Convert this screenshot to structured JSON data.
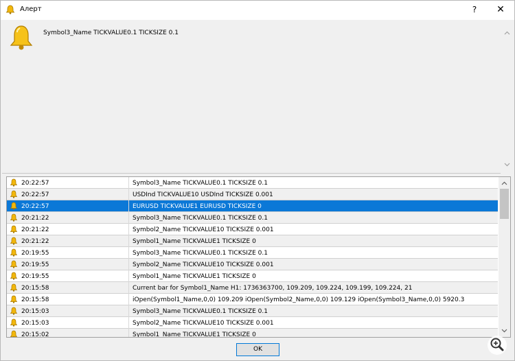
{
  "window": {
    "title": "Алерт",
    "help_label": "?",
    "close_label": "✕"
  },
  "message": {
    "text": "Symbol3_Name TICKVALUE0.1 TICKSIZE 0.1"
  },
  "alerts": [
    {
      "time": "20:22:57",
      "message": "Symbol3_Name TICKVALUE0.1 TICKSIZE 0.1",
      "selected": false
    },
    {
      "time": "20:22:57",
      "message": "USDInd TICKVALUE10 USDInd TICKSIZE 0.001",
      "selected": false
    },
    {
      "time": "20:22:57",
      "message": "EURUSD TICKVALUE1 EURUSD TICKSIZE 0",
      "selected": true
    },
    {
      "time": "20:21:22",
      "message": "Symbol3_Name TICKVALUE0.1 TICKSIZE 0.1",
      "selected": false
    },
    {
      "time": "20:21:22",
      "message": "Symbol2_Name TICKVALUE10 TICKSIZE 0.001",
      "selected": false
    },
    {
      "time": "20:21:22",
      "message": "Symbol1_Name TICKVALUE1 TICKSIZE 0",
      "selected": false
    },
    {
      "time": "20:19:55",
      "message": "Symbol3_Name TICKVALUE0.1 TICKSIZE 0.1",
      "selected": false
    },
    {
      "time": "20:19:55",
      "message": "Symbol2_Name TICKVALUE10 TICKSIZE 0.001",
      "selected": false
    },
    {
      "time": "20:19:55",
      "message": "Symbol1_Name TICKVALUE1 TICKSIZE 0",
      "selected": false
    },
    {
      "time": "20:15:58",
      "message": "Current bar for Symbol1_Name H1: 1736363700, 109.209, 109.224, 109.199, 109.224, 21",
      "selected": false
    },
    {
      "time": "20:15:58",
      "message": " iOpen(Symbol1_Name,0,0) 109.209 iOpen(Symbol2_Name,0,0) 109.129 iOpen(Symbol3_Name,0,0) 5920.3",
      "selected": false
    },
    {
      "time": "20:15:03",
      "message": "Symbol3_Name TICKVALUE0.1 TICKSIZE 0.1",
      "selected": false
    },
    {
      "time": "20:15:03",
      "message": "Symbol2_Name TICKVALUE10 TICKSIZE 0.001",
      "selected": false
    },
    {
      "time": "20:15:02",
      "message": "Symbol1_Name TICKVALUE1 TICKSIZE 0",
      "selected": false
    }
  ],
  "footer": {
    "ok_label": "OK"
  },
  "icons": {
    "app": "bell-icon",
    "message": "bell-icon",
    "row": "bell-icon",
    "zoom": "zoom-in-icon"
  },
  "colors": {
    "selection": "#0b78d7",
    "bell": "#f2b70c"
  }
}
